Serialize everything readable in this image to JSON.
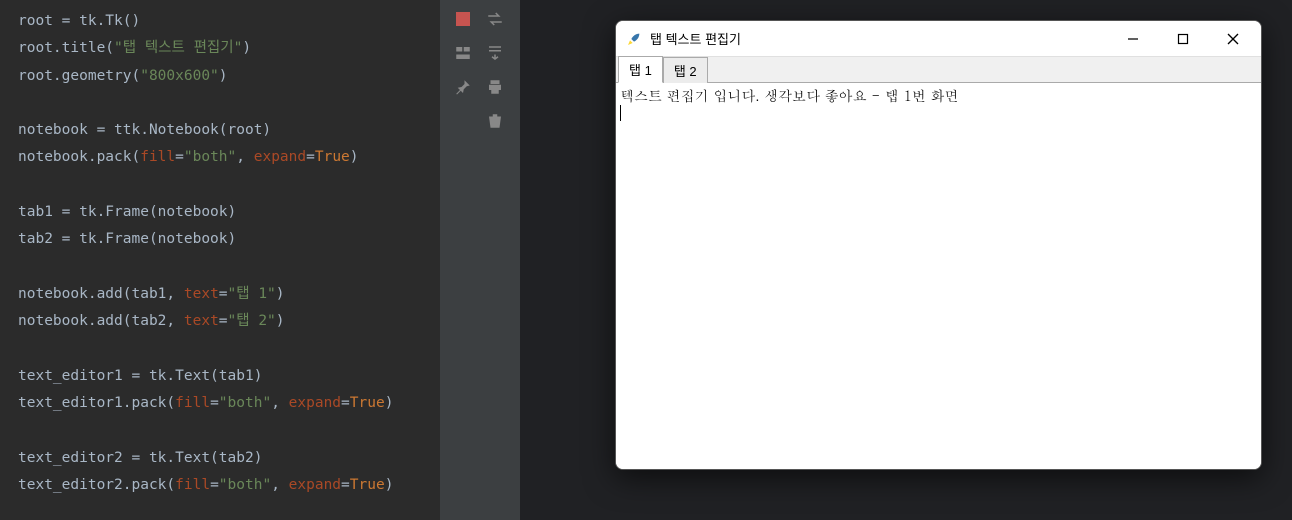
{
  "code": {
    "l1a": "root = tk.Tk()",
    "l2a": "root.title(",
    "l2s": "\"탭 텍스트 편집기\"",
    "l2b": ")",
    "l3a": "root.geometry(",
    "l3s": "\"800x600\"",
    "l3b": ")",
    "l5a": "notebook = ttk.Notebook(root)",
    "l6a": "notebook.pack(",
    "l6p1": "fill",
    "l6e": "=",
    "l6s": "\"both\"",
    "l6c": ", ",
    "l6p2": "expand",
    "l6e2": "=",
    "l6t": "True",
    "l6b": ")",
    "l8a": "tab1 = tk.Frame(notebook)",
    "l9a": "tab2 = tk.Frame(notebook)",
    "l11a": "notebook.add(tab1, ",
    "l11p": "text",
    "l11e": "=",
    "l11s": "\"탭 1\"",
    "l11b": ")",
    "l12a": "notebook.add(tab2, ",
    "l12p": "text",
    "l12e": "=",
    "l12s": "\"탭 2\"",
    "l12b": ")",
    "l14a": "text_editor1 = tk.Text(tab1)",
    "l15a": "text_editor1.pack(",
    "l15p1": "fill",
    "l15e": "=",
    "l15s": "\"both\"",
    "l15c": ", ",
    "l15p2": "expand",
    "l15e2": "=",
    "l15t": "True",
    "l15b": ")",
    "l17a": "text_editor2 = tk.Text(tab2)",
    "l18a": "text_editor2.pack(",
    "l18p1": "fill",
    "l18e": "=",
    "l18s": "\"both\"",
    "l18c": ", ",
    "l18p2": "expand",
    "l18e2": "=",
    "l18t": "True",
    "l18b": ")"
  },
  "toolbar": {
    "stop": "stop",
    "rerun": "rerun",
    "layout": "layout",
    "stepdown": "step-down",
    "pin": "pin",
    "print": "print",
    "trash": "trash"
  },
  "window": {
    "title": "탭 텍스트 편집기",
    "tabs": [
      {
        "label": "탭 1",
        "active": true
      },
      {
        "label": "탭 2",
        "active": false
      }
    ],
    "text": "텍스트 편집기 입니다. 생각보다 좋아요 - 탭 1번 화면"
  }
}
